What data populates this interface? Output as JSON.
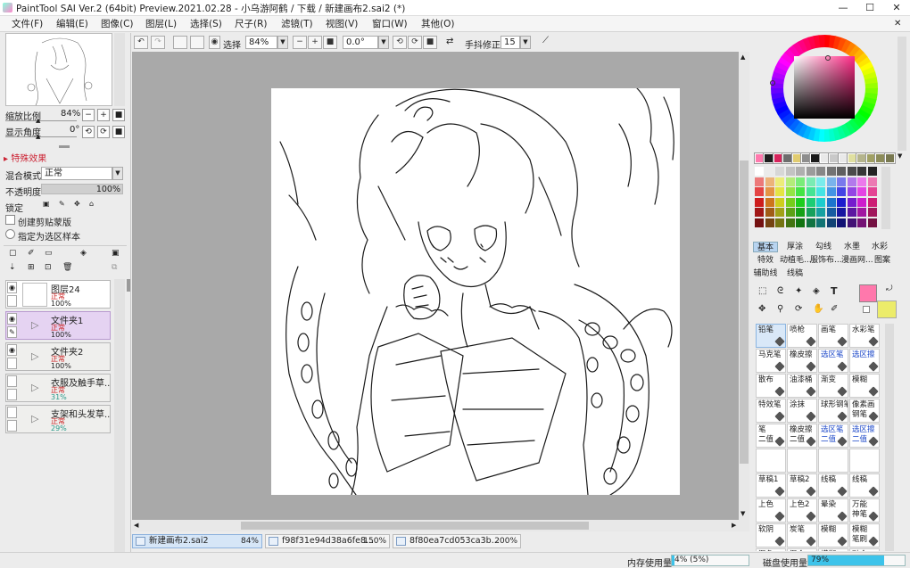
{
  "window": {
    "title": "PaintTool SAI Ver.2 (64bit) Preview.2021.02.28 - 小乌游阿鹤 / 下载 / 新建画布2.sai2 (*)",
    "minimize": "—",
    "maximize": "☐",
    "close": "✕"
  },
  "menu": {
    "items": [
      "文件(F)",
      "编辑(E)",
      "图像(C)",
      "图层(L)",
      "选择(S)",
      "尺子(R)",
      "滤镜(T)",
      "视图(V)",
      "窗口(W)",
      "其他(O)"
    ],
    "close": "✕"
  },
  "toolbar": {
    "select_label": "选择",
    "zoom": "84%",
    "rotation": "0.0°",
    "stabilizer_label": "手抖修正",
    "stabilizer_value": "15"
  },
  "navigator": {
    "zoom_label": "缩放比例",
    "zoom_value": "84%",
    "angle_label": "显示角度",
    "angle_value": "0°"
  },
  "layer_props": {
    "effects_label": "特殊效果",
    "blend_label": "混合模式",
    "blend_value": "正常",
    "opacity_label": "不透明度",
    "opacity_value": "100%",
    "opacity_fraction": 1.0,
    "lock_label": "锁定",
    "clip_label": "创建剪贴蒙版",
    "sample_label": "指定为选区样本"
  },
  "layers": [
    {
      "name": "图层24",
      "mode": "正常",
      "opacity": "100%",
      "type": "layer",
      "selected": false,
      "teal": false
    },
    {
      "name": "文件夹1",
      "mode": "正常",
      "opacity": "100%",
      "type": "folder",
      "selected": true,
      "teal": false
    },
    {
      "name": "文件夹2",
      "mode": "正常",
      "opacity": "100%",
      "type": "folder",
      "selected": false,
      "teal": false
    },
    {
      "name": "衣服及触手草...",
      "mode": "正常",
      "opacity": "31%",
      "type": "folder",
      "selected": false,
      "teal": true
    },
    {
      "name": "支架和头发草...",
      "mode": "正常",
      "opacity": "29%",
      "type": "folder",
      "selected": false,
      "teal": true
    }
  ],
  "doc_tabs": [
    {
      "name": "新建画布2.sai2",
      "zoom": "84%",
      "active": true
    },
    {
      "name": "f98f31e94d38a6fe8...",
      "zoom": "150%",
      "active": false
    },
    {
      "name": "8f80ea7cd053ca3b...",
      "zoom": "200%",
      "active": false
    }
  ],
  "status": {
    "memory_label": "内存使用量",
    "memory_value": "4% (5%)",
    "memory_fraction": 0.04,
    "disk_label": "磁盘使用量",
    "disk_value": "79%",
    "disk_fraction": 0.79
  },
  "colors": {
    "primary": "#ff78ac",
    "secondary": "#ecec6a",
    "accent": "#3dc3ea"
  },
  "palette_row": [
    "#ff79ad",
    "#1e1e1e",
    "#d6245c",
    "#6d6d6d",
    "#e1cc71",
    "#8d8d8d",
    "#1a1a1a",
    "#e9e9e9",
    "#c9c9c9",
    "#e9e9e9",
    "#e0e0a0",
    "#b4b48c",
    "#a0a064",
    "#8c8c5a",
    "#787850"
  ],
  "brush_tabs": [
    "基本",
    "厚涂",
    "勾线",
    "水墨",
    "水彩",
    "特效",
    "动植毛...",
    "服饰布...",
    "漫画网...",
    "图案",
    "辅助线",
    "线稿"
  ],
  "brushes": [
    {
      "name": "铅笔",
      "sub": "",
      "blue": false,
      "selected": true
    },
    {
      "name": "喷枪",
      "sub": "",
      "blue": false,
      "selected": false
    },
    {
      "name": "画笔",
      "sub": "",
      "blue": false,
      "selected": false
    },
    {
      "name": "水彩笔",
      "sub": "",
      "blue": false,
      "selected": false
    },
    {
      "name": "马克笔",
      "sub": "",
      "blue": false,
      "selected": false
    },
    {
      "name": "橡皮擦",
      "sub": "",
      "blue": false,
      "selected": false
    },
    {
      "name": "选区笔",
      "sub": "",
      "blue": true,
      "selected": false
    },
    {
      "name": "选区擦",
      "sub": "",
      "blue": true,
      "selected": false
    },
    {
      "name": "散布",
      "sub": "",
      "blue": false,
      "selected": false
    },
    {
      "name": "油漆桶",
      "sub": "",
      "blue": false,
      "selected": false
    },
    {
      "name": "渐变",
      "sub": "",
      "blue": false,
      "selected": false
    },
    {
      "name": "模糊",
      "sub": "",
      "blue": false,
      "selected": false
    },
    {
      "name": "特效笔",
      "sub": "",
      "blue": false,
      "selected": false
    },
    {
      "name": "涂抹",
      "sub": "",
      "blue": false,
      "selected": false
    },
    {
      "name": "球形钢笔",
      "sub": "",
      "blue": false,
      "selected": false
    },
    {
      "name": "像素画",
      "sub": "钢笔",
      "blue": false,
      "selected": false
    },
    {
      "name": "笔",
      "sub": "二值",
      "blue": false,
      "selected": false
    },
    {
      "name": "橡皮擦",
      "sub": "二值",
      "blue": false,
      "selected": false
    },
    {
      "name": "选区笔",
      "sub": "二值",
      "blue": true,
      "selected": false
    },
    {
      "name": "选区擦",
      "sub": "二值",
      "blue": true,
      "selected": false
    },
    {
      "name": "",
      "sub": "",
      "blue": false,
      "selected": false
    },
    {
      "name": "",
      "sub": "",
      "blue": false,
      "selected": false
    },
    {
      "name": "",
      "sub": "",
      "blue": false,
      "selected": false
    },
    {
      "name": "",
      "sub": "",
      "blue": false,
      "selected": false
    },
    {
      "name": "草稿1",
      "sub": "",
      "blue": false,
      "selected": false
    },
    {
      "name": "草稿2",
      "sub": "",
      "blue": false,
      "selected": false
    },
    {
      "name": "线稿",
      "sub": "",
      "blue": false,
      "selected": false
    },
    {
      "name": "线稿",
      "sub": "",
      "blue": false,
      "selected": false
    },
    {
      "name": "上色",
      "sub": "",
      "blue": false,
      "selected": false
    },
    {
      "name": "上色2",
      "sub": "",
      "blue": false,
      "selected": false
    },
    {
      "name": "晕染",
      "sub": "",
      "blue": false,
      "selected": false
    },
    {
      "name": "万能",
      "sub": "神笔",
      "blue": false,
      "selected": false
    },
    {
      "name": "软阴",
      "sub": "",
      "blue": false,
      "selected": false
    },
    {
      "name": "炭笔",
      "sub": "",
      "blue": false,
      "selected": false
    },
    {
      "name": "模糊",
      "sub": "",
      "blue": false,
      "selected": false
    },
    {
      "name": "模糊",
      "sub": "笔刷",
      "blue": false,
      "selected": false
    },
    {
      "name": "混色",
      "sub": "",
      "blue": false,
      "selected": false
    },
    {
      "name": "混合",
      "sub": "",
      "blue": false,
      "selected": false
    },
    {
      "name": "模糊",
      "sub": "",
      "blue": false,
      "selected": false
    },
    {
      "name": "融合",
      "sub": "",
      "blue": false,
      "selected": false
    }
  ]
}
